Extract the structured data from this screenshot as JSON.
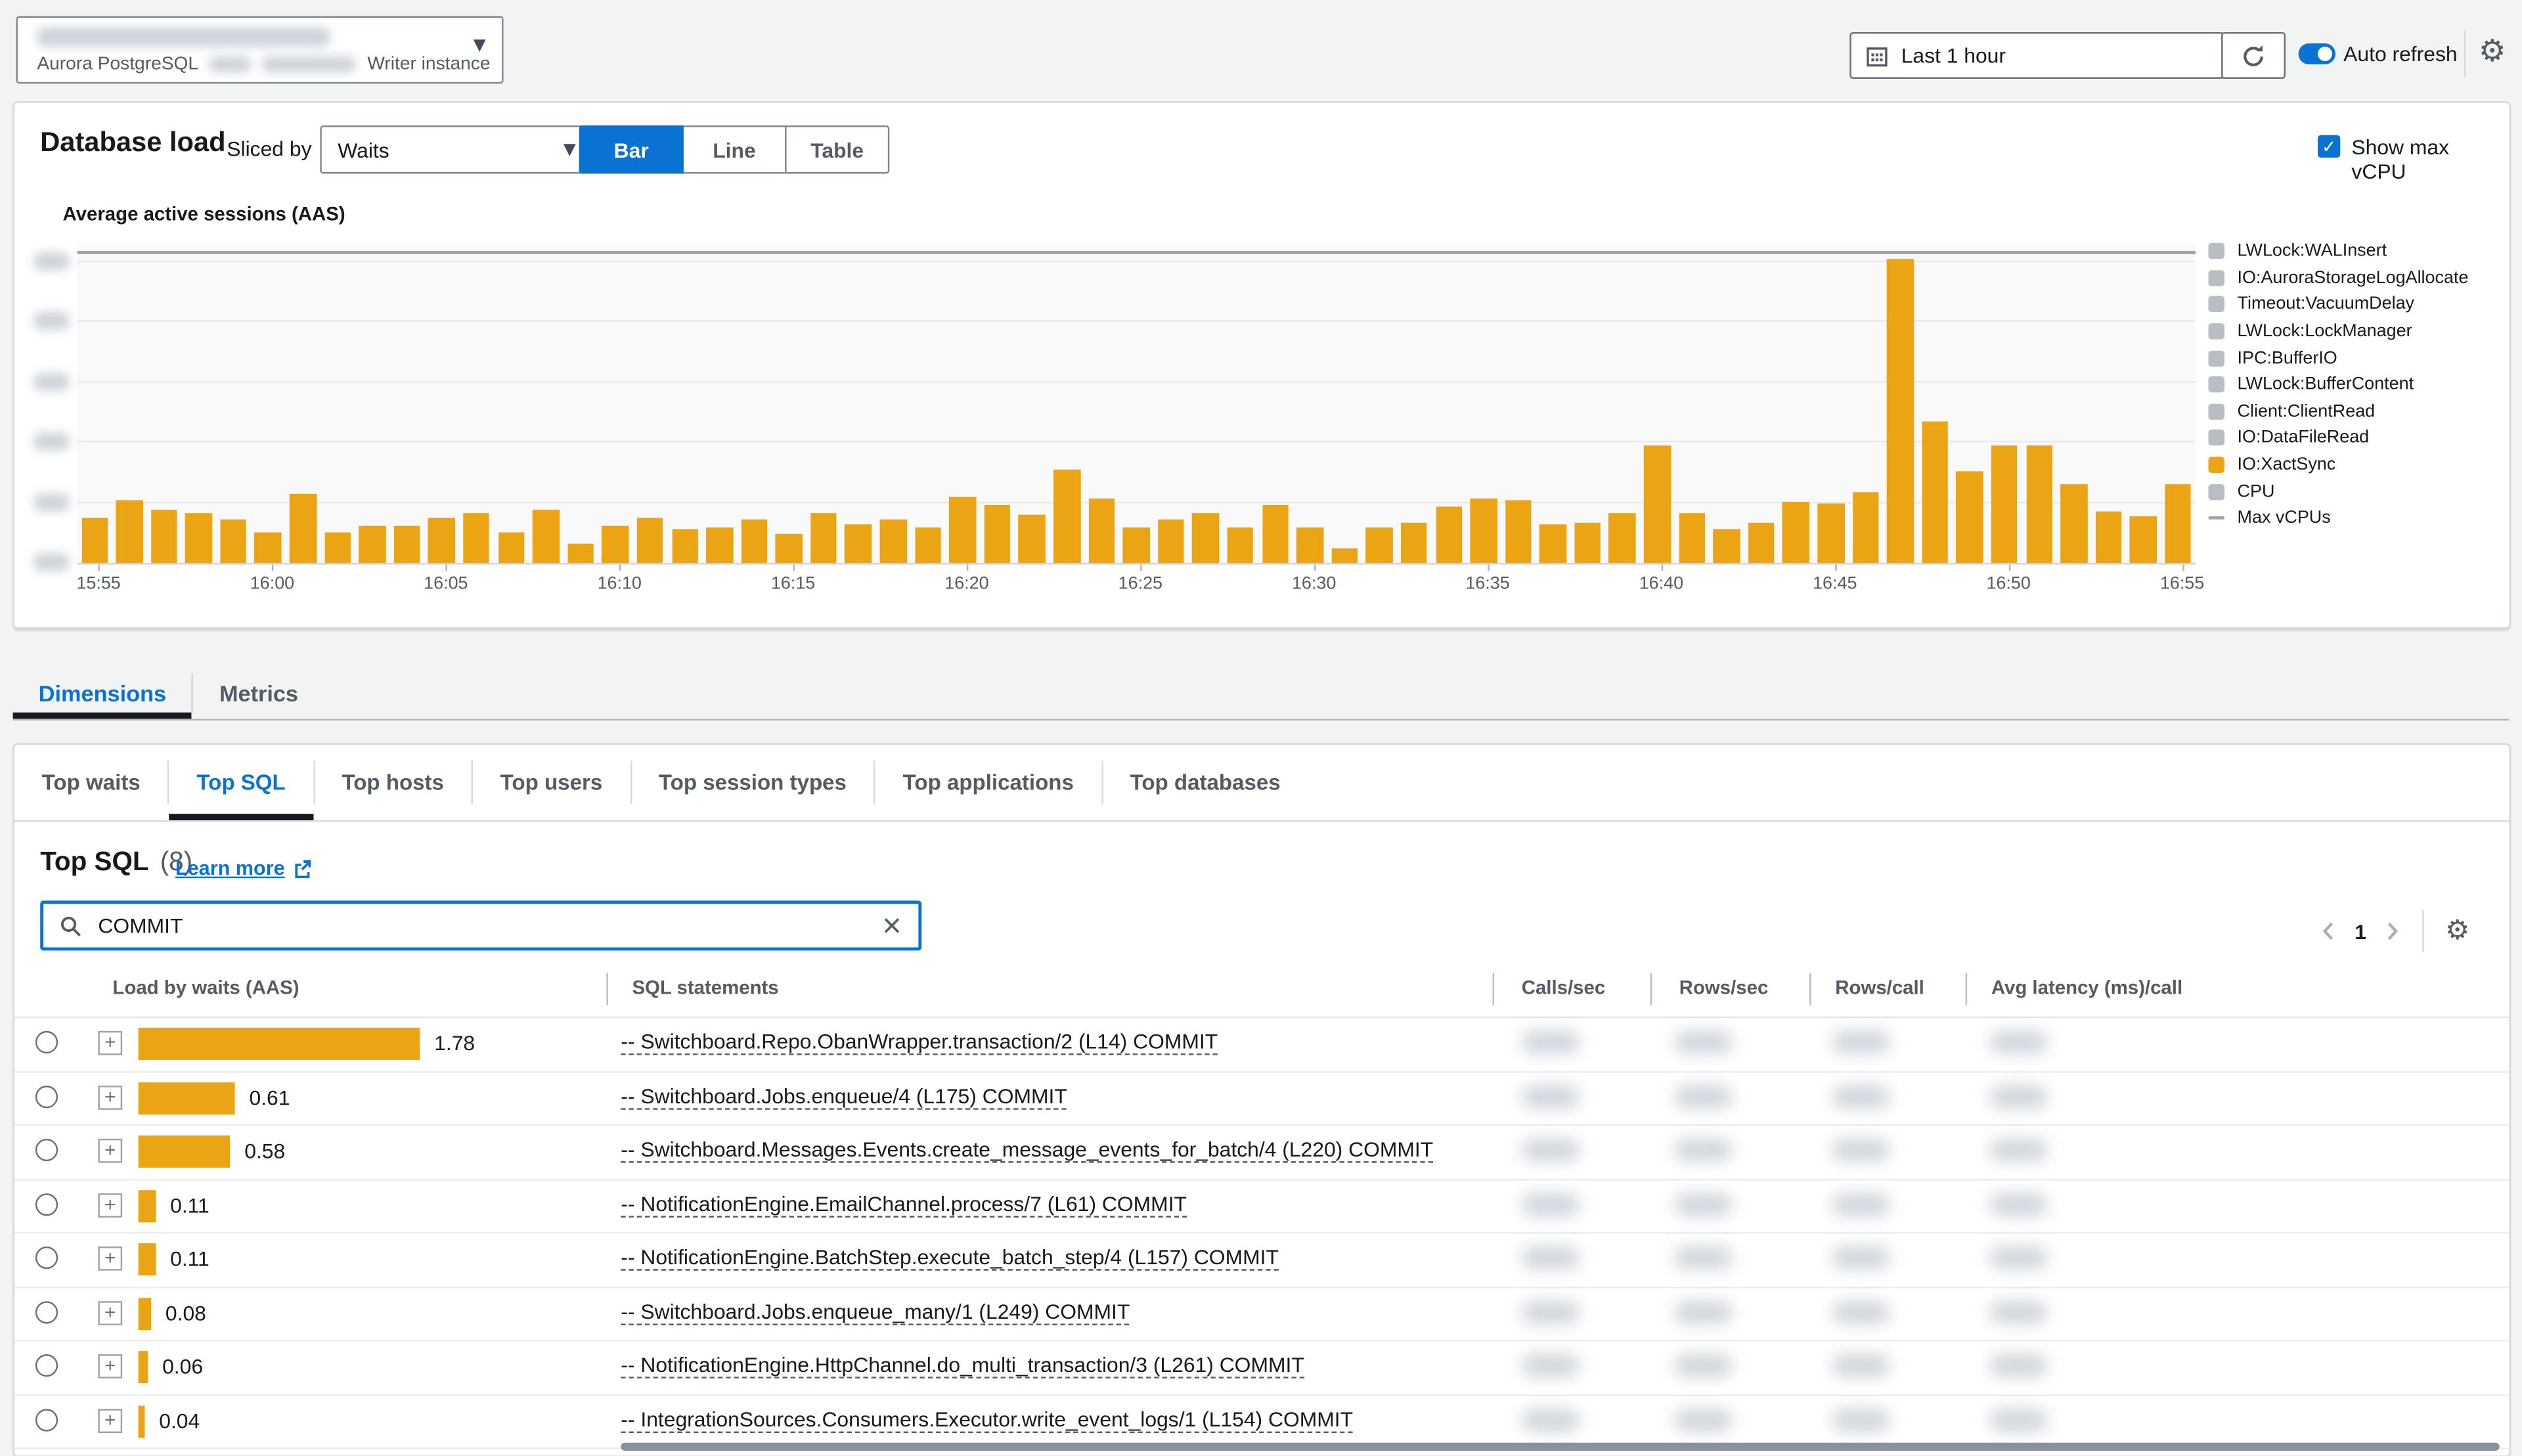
{
  "header": {
    "instance": {
      "engine": "Aurora PostgreSQL",
      "role": "Writer instance",
      "name_redacted": true
    },
    "time_range": {
      "label": "Last 1 hour"
    },
    "auto_refresh_label": "Auto refresh",
    "auto_refresh_on": true
  },
  "database_load": {
    "title": "Database load",
    "sliced_by_label": "Sliced by",
    "slice_value": "Waits",
    "view_options": [
      "Bar",
      "Line",
      "Table"
    ],
    "active_view": "Bar",
    "show_max_vcpu_label": "Show max vCPU",
    "show_max_vcpu_checked": true
  },
  "chart_data": {
    "type": "bar",
    "title": "Average active sessions (AAS)",
    "series_name": "IO:XactSync",
    "bar_color": "#eaa414",
    "x_start": "15:55",
    "x_end": "16:55",
    "interval_minutes": 1,
    "x_tick_labels": [
      "15:55",
      "16:00",
      "16:05",
      "16:10",
      "16:15",
      "16:20",
      "16:25",
      "16:30",
      "16:35",
      "16:40",
      "16:45",
      "16:50",
      "16:55"
    ],
    "values": [
      0.38,
      0.52,
      0.44,
      0.41,
      0.36,
      0.26,
      0.58,
      0.26,
      0.31,
      0.31,
      0.38,
      0.42,
      0.25,
      0.44,
      0.16,
      0.31,
      0.38,
      0.28,
      0.29,
      0.36,
      0.24,
      0.42,
      0.32,
      0.36,
      0.3,
      0.55,
      0.48,
      0.4,
      0.78,
      0.54,
      0.3,
      0.36,
      0.42,
      0.29,
      0.48,
      0.3,
      0.12,
      0.3,
      0.33,
      0.47,
      0.53,
      0.52,
      0.32,
      0.33,
      0.42,
      0.97,
      0.41,
      0.28,
      0.33,
      0.51,
      0.5,
      0.59,
      2.52,
      1.17,
      0.76,
      0.97,
      0.98,
      0.66,
      0.43,
      0.39,
      0.66
    ],
    "ylim": [
      0,
      2.65
    ],
    "gridline_values": [
      0.5,
      1.0,
      1.5,
      2.0,
      2.5
    ],
    "y_axis_labels_redacted": true,
    "max_vcpus_value": 2.56,
    "grid": true,
    "legend_position": "right",
    "legend": [
      {
        "label": "LWLock:WALInsert",
        "color": "#b7bfc4",
        "type": "box"
      },
      {
        "label": "IO:AuroraStorageLogAllocate",
        "color": "#b7bfc4",
        "type": "box"
      },
      {
        "label": "Timeout:VacuumDelay",
        "color": "#b7bfc4",
        "type": "box"
      },
      {
        "label": "LWLock:LockManager",
        "color": "#b7bfc4",
        "type": "box"
      },
      {
        "label": "IPC:BufferIO",
        "color": "#b7bfc4",
        "type": "box"
      },
      {
        "label": "LWLock:BufferContent",
        "color": "#b7bfc4",
        "type": "box"
      },
      {
        "label": "Client:ClientRead",
        "color": "#b7bfc4",
        "type": "box"
      },
      {
        "label": "IO:DataFileRead",
        "color": "#b7bfc4",
        "type": "box"
      },
      {
        "label": "IO:XactSync",
        "color": "#eaa414",
        "type": "box"
      },
      {
        "label": "CPU",
        "color": "#b7bfc4",
        "type": "box"
      },
      {
        "label": "Max vCPUs",
        "color": "#9aa5ad",
        "type": "line"
      }
    ]
  },
  "tabs": {
    "items": [
      "Dimensions",
      "Metrics"
    ],
    "active": "Dimensions"
  },
  "dimension_tabs": {
    "items": [
      "Top waits",
      "Top SQL",
      "Top hosts",
      "Top users",
      "Top session types",
      "Top applications",
      "Top databases"
    ],
    "active": "Top SQL"
  },
  "top_sql": {
    "title": "Top SQL",
    "count": "(8)",
    "learn_more_label": "Learn more",
    "search_value": "COMMIT",
    "pagination": {
      "current_page": "1"
    },
    "table": {
      "columns": [
        "Load by waits (AAS)",
        "SQL statements",
        "Calls/sec",
        "Rows/sec",
        "Rows/call",
        "Avg latency (ms)/call"
      ],
      "metric_values_redacted": true,
      "rows": [
        {
          "load": 1.78,
          "load_label": "1.78",
          "sql": "-- Switchboard.Repo.ObanWrapper.transaction/2 (L14) COMMIT"
        },
        {
          "load": 0.61,
          "load_label": "0.61",
          "sql": "-- Switchboard.Jobs.enqueue/4 (L175) COMMIT"
        },
        {
          "load": 0.58,
          "load_label": "0.58",
          "sql": "-- Switchboard.Messages.Events.create_message_events_for_batch/4 (L220) COMMIT"
        },
        {
          "load": 0.11,
          "load_label": "0.11",
          "sql": "-- NotificationEngine.EmailChannel.process/7 (L61) COMMIT"
        },
        {
          "load": 0.11,
          "load_label": "0.11",
          "sql": "-- NotificationEngine.BatchStep.execute_batch_step/4 (L157) COMMIT"
        },
        {
          "load": 0.08,
          "load_label": "0.08",
          "sql": "-- Switchboard.Jobs.enqueue_many/1 (L249) COMMIT"
        },
        {
          "load": 0.06,
          "load_label": "0.06",
          "sql": "-- NotificationEngine.HttpChannel.do_multi_transaction/3 (L261) COMMIT"
        },
        {
          "load": 0.04,
          "load_label": "0.04",
          "sql": "-- IntegrationSources.Consumers.Executor.write_event_logs/1 (L154) COMMIT"
        }
      ]
    }
  },
  "colors": {
    "accent_blue": "#0972d3",
    "bar_orange": "#eaa414",
    "legend_gray": "#b7bfc4",
    "text_primary": "#16191f",
    "text_secondary": "#545b64",
    "page_bg": "#f2f3f3"
  }
}
